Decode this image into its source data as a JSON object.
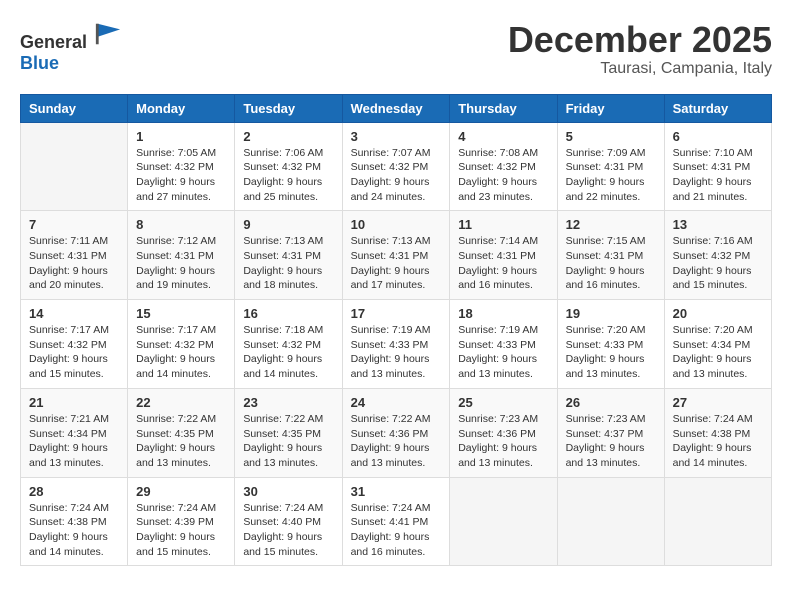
{
  "logo": {
    "general": "General",
    "blue": "Blue"
  },
  "header": {
    "month": "December 2025",
    "location": "Taurasi, Campania, Italy"
  },
  "weekdays": [
    "Sunday",
    "Monday",
    "Tuesday",
    "Wednesday",
    "Thursday",
    "Friday",
    "Saturday"
  ],
  "weeks": [
    [
      {
        "day": "",
        "sunrise": "",
        "sunset": "",
        "daylight": ""
      },
      {
        "day": "1",
        "sunrise": "Sunrise: 7:05 AM",
        "sunset": "Sunset: 4:32 PM",
        "daylight": "Daylight: 9 hours and 27 minutes."
      },
      {
        "day": "2",
        "sunrise": "Sunrise: 7:06 AM",
        "sunset": "Sunset: 4:32 PM",
        "daylight": "Daylight: 9 hours and 25 minutes."
      },
      {
        "day": "3",
        "sunrise": "Sunrise: 7:07 AM",
        "sunset": "Sunset: 4:32 PM",
        "daylight": "Daylight: 9 hours and 24 minutes."
      },
      {
        "day": "4",
        "sunrise": "Sunrise: 7:08 AM",
        "sunset": "Sunset: 4:32 PM",
        "daylight": "Daylight: 9 hours and 23 minutes."
      },
      {
        "day": "5",
        "sunrise": "Sunrise: 7:09 AM",
        "sunset": "Sunset: 4:31 PM",
        "daylight": "Daylight: 9 hours and 22 minutes."
      },
      {
        "day": "6",
        "sunrise": "Sunrise: 7:10 AM",
        "sunset": "Sunset: 4:31 PM",
        "daylight": "Daylight: 9 hours and 21 minutes."
      }
    ],
    [
      {
        "day": "7",
        "sunrise": "Sunrise: 7:11 AM",
        "sunset": "Sunset: 4:31 PM",
        "daylight": "Daylight: 9 hours and 20 minutes."
      },
      {
        "day": "8",
        "sunrise": "Sunrise: 7:12 AM",
        "sunset": "Sunset: 4:31 PM",
        "daylight": "Daylight: 9 hours and 19 minutes."
      },
      {
        "day": "9",
        "sunrise": "Sunrise: 7:13 AM",
        "sunset": "Sunset: 4:31 PM",
        "daylight": "Daylight: 9 hours and 18 minutes."
      },
      {
        "day": "10",
        "sunrise": "Sunrise: 7:13 AM",
        "sunset": "Sunset: 4:31 PM",
        "daylight": "Daylight: 9 hours and 17 minutes."
      },
      {
        "day": "11",
        "sunrise": "Sunrise: 7:14 AM",
        "sunset": "Sunset: 4:31 PM",
        "daylight": "Daylight: 9 hours and 16 minutes."
      },
      {
        "day": "12",
        "sunrise": "Sunrise: 7:15 AM",
        "sunset": "Sunset: 4:31 PM",
        "daylight": "Daylight: 9 hours and 16 minutes."
      },
      {
        "day": "13",
        "sunrise": "Sunrise: 7:16 AM",
        "sunset": "Sunset: 4:32 PM",
        "daylight": "Daylight: 9 hours and 15 minutes."
      }
    ],
    [
      {
        "day": "14",
        "sunrise": "Sunrise: 7:17 AM",
        "sunset": "Sunset: 4:32 PM",
        "daylight": "Daylight: 9 hours and 15 minutes."
      },
      {
        "day": "15",
        "sunrise": "Sunrise: 7:17 AM",
        "sunset": "Sunset: 4:32 PM",
        "daylight": "Daylight: 9 hours and 14 minutes."
      },
      {
        "day": "16",
        "sunrise": "Sunrise: 7:18 AM",
        "sunset": "Sunset: 4:32 PM",
        "daylight": "Daylight: 9 hours and 14 minutes."
      },
      {
        "day": "17",
        "sunrise": "Sunrise: 7:19 AM",
        "sunset": "Sunset: 4:33 PM",
        "daylight": "Daylight: 9 hours and 13 minutes."
      },
      {
        "day": "18",
        "sunrise": "Sunrise: 7:19 AM",
        "sunset": "Sunset: 4:33 PM",
        "daylight": "Daylight: 9 hours and 13 minutes."
      },
      {
        "day": "19",
        "sunrise": "Sunrise: 7:20 AM",
        "sunset": "Sunset: 4:33 PM",
        "daylight": "Daylight: 9 hours and 13 minutes."
      },
      {
        "day": "20",
        "sunrise": "Sunrise: 7:20 AM",
        "sunset": "Sunset: 4:34 PM",
        "daylight": "Daylight: 9 hours and 13 minutes."
      }
    ],
    [
      {
        "day": "21",
        "sunrise": "Sunrise: 7:21 AM",
        "sunset": "Sunset: 4:34 PM",
        "daylight": "Daylight: 9 hours and 13 minutes."
      },
      {
        "day": "22",
        "sunrise": "Sunrise: 7:22 AM",
        "sunset": "Sunset: 4:35 PM",
        "daylight": "Daylight: 9 hours and 13 minutes."
      },
      {
        "day": "23",
        "sunrise": "Sunrise: 7:22 AM",
        "sunset": "Sunset: 4:35 PM",
        "daylight": "Daylight: 9 hours and 13 minutes."
      },
      {
        "day": "24",
        "sunrise": "Sunrise: 7:22 AM",
        "sunset": "Sunset: 4:36 PM",
        "daylight": "Daylight: 9 hours and 13 minutes."
      },
      {
        "day": "25",
        "sunrise": "Sunrise: 7:23 AM",
        "sunset": "Sunset: 4:36 PM",
        "daylight": "Daylight: 9 hours and 13 minutes."
      },
      {
        "day": "26",
        "sunrise": "Sunrise: 7:23 AM",
        "sunset": "Sunset: 4:37 PM",
        "daylight": "Daylight: 9 hours and 13 minutes."
      },
      {
        "day": "27",
        "sunrise": "Sunrise: 7:24 AM",
        "sunset": "Sunset: 4:38 PM",
        "daylight": "Daylight: 9 hours and 14 minutes."
      }
    ],
    [
      {
        "day": "28",
        "sunrise": "Sunrise: 7:24 AM",
        "sunset": "Sunset: 4:38 PM",
        "daylight": "Daylight: 9 hours and 14 minutes."
      },
      {
        "day": "29",
        "sunrise": "Sunrise: 7:24 AM",
        "sunset": "Sunset: 4:39 PM",
        "daylight": "Daylight: 9 hours and 15 minutes."
      },
      {
        "day": "30",
        "sunrise": "Sunrise: 7:24 AM",
        "sunset": "Sunset: 4:40 PM",
        "daylight": "Daylight: 9 hours and 15 minutes."
      },
      {
        "day": "31",
        "sunrise": "Sunrise: 7:24 AM",
        "sunset": "Sunset: 4:41 PM",
        "daylight": "Daylight: 9 hours and 16 minutes."
      },
      {
        "day": "",
        "sunrise": "",
        "sunset": "",
        "daylight": ""
      },
      {
        "day": "",
        "sunrise": "",
        "sunset": "",
        "daylight": ""
      },
      {
        "day": "",
        "sunrise": "",
        "sunset": "",
        "daylight": ""
      }
    ]
  ]
}
